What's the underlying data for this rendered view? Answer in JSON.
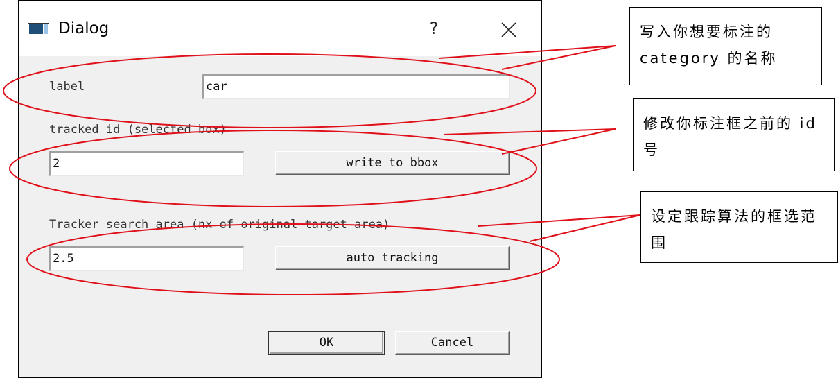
{
  "window": {
    "title": "Dialog",
    "help_glyph": "?"
  },
  "form": {
    "label_caption": "label",
    "label_value": "car",
    "tracked_id_caption": "tracked id (selected box)",
    "tracked_id_value": "2",
    "write_button": "write to bbox",
    "search_area_caption": "Tracker search area (nx of original target area)",
    "search_area_value": "2.5",
    "auto_tracking_button": "auto tracking",
    "ok_button": "OK",
    "cancel_button": "Cancel"
  },
  "annotations": {
    "note1": "写入你想要标注的category 的名称",
    "note2": "修改你标注框之前的 id 号",
    "note3": "设定跟踪算法的框选范围"
  },
  "colors": {
    "annotation": "#e0101a",
    "dialog_bg": "#f0f0f0"
  },
  "icons": [
    "window-app-icon",
    "close-icon"
  ]
}
